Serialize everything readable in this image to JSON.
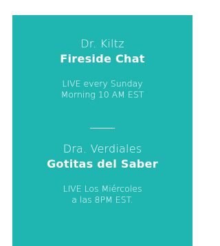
{
  "cards": [
    {
      "name": "Dr. Kiltz",
      "show": "Fireside Chat",
      "schedule_line1": "LIVE every Sunday",
      "schedule_line2": "Morning 10 AM EST"
    },
    {
      "name": "Dra. Verdiales",
      "show": "Gotitas del Saber",
      "schedule_line1": "LIVE Los Miércoles",
      "schedule_line2": "a las 8PM EST."
    }
  ],
  "colors": {
    "panel_background": "#1fb6b2",
    "text": "#ffffff"
  }
}
